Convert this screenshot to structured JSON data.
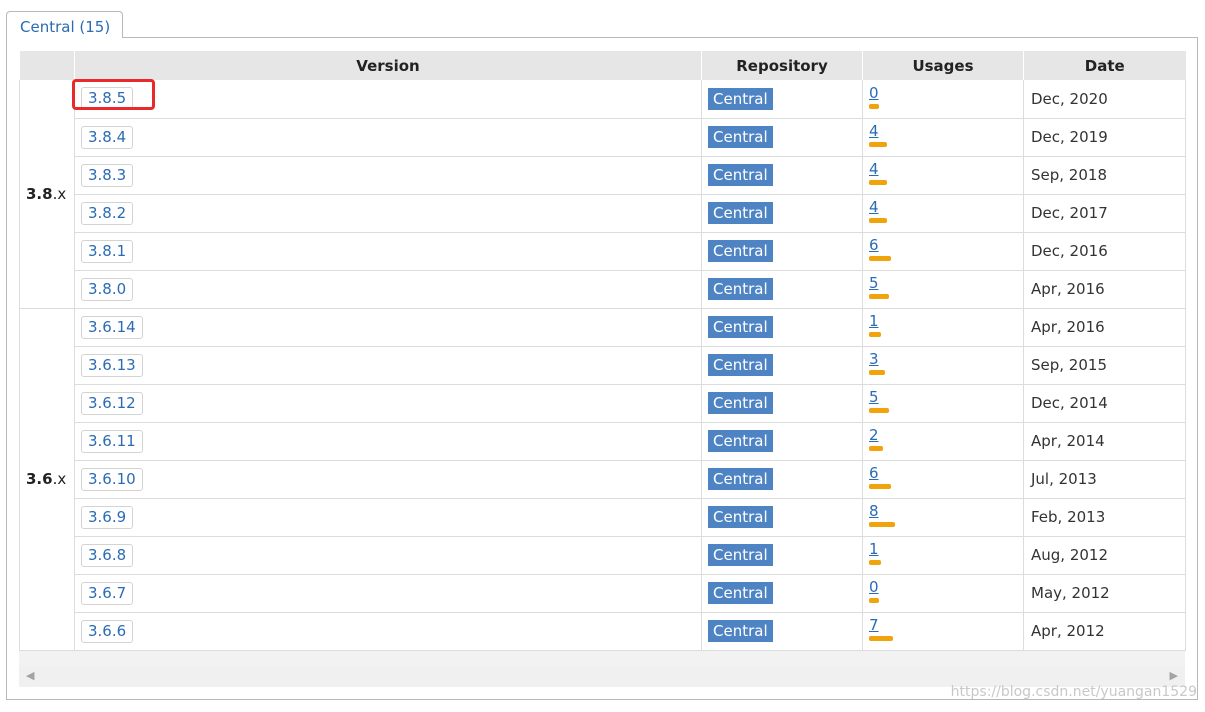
{
  "tab": {
    "label": "Central (15)"
  },
  "headers": {
    "group": "",
    "version": "Version",
    "repository": "Repository",
    "usages": "Usages",
    "date": "Date"
  },
  "groups": [
    {
      "bold": "3.8",
      "suffix": ".x",
      "rows": [
        {
          "version": "3.8.5",
          "repo": "Central",
          "usages": "0",
          "bar": 0.0,
          "date": "Dec, 2020",
          "highlight": true
        },
        {
          "version": "3.8.4",
          "repo": "Central",
          "usages": "4",
          "bar": 4,
          "date": "Dec, 2019"
        },
        {
          "version": "3.8.3",
          "repo": "Central",
          "usages": "4",
          "bar": 4,
          "date": "Sep, 2018"
        },
        {
          "version": "3.8.2",
          "repo": "Central",
          "usages": "4",
          "bar": 4,
          "date": "Dec, 2017"
        },
        {
          "version": "3.8.1",
          "repo": "Central",
          "usages": "6",
          "bar": 6,
          "date": "Dec, 2016"
        },
        {
          "version": "3.8.0",
          "repo": "Central",
          "usages": "5",
          "bar": 5,
          "date": "Apr, 2016"
        }
      ]
    },
    {
      "bold": "3.6",
      "suffix": ".x",
      "rows": [
        {
          "version": "3.6.14",
          "repo": "Central",
          "usages": "1",
          "bar": 1,
          "date": "Apr, 2016"
        },
        {
          "version": "3.6.13",
          "repo": "Central",
          "usages": "3",
          "bar": 3,
          "date": "Sep, 2015"
        },
        {
          "version": "3.6.12",
          "repo": "Central",
          "usages": "5",
          "bar": 5,
          "date": "Dec, 2014"
        },
        {
          "version": "3.6.11",
          "repo": "Central",
          "usages": "2",
          "bar": 2,
          "date": "Apr, 2014"
        },
        {
          "version": "3.6.10",
          "repo": "Central",
          "usages": "6",
          "bar": 6,
          "date": "Jul, 2013"
        },
        {
          "version": "3.6.9",
          "repo": "Central",
          "usages": "8",
          "bar": 8,
          "date": "Feb, 2013"
        },
        {
          "version": "3.6.8",
          "repo": "Central",
          "usages": "1",
          "bar": 1,
          "date": "Aug, 2012"
        },
        {
          "version": "3.6.7",
          "repo": "Central",
          "usages": "0",
          "bar": 0.0,
          "date": "May, 2012"
        },
        {
          "version": "3.6.6",
          "repo": "Central",
          "usages": "7",
          "bar": 7,
          "date": "Apr, 2012"
        }
      ]
    }
  ],
  "colors": {
    "link": "#2a6bb5",
    "repo_badge": "#4f84c4",
    "usage_bar": "#f0a30a",
    "highlight": "#e82a2a"
  },
  "scrollbar": {
    "left_icon": "triangle-left-icon",
    "right_icon": "triangle-right-icon"
  },
  "watermark": "https://blog.csdn.net/yuangan1529"
}
